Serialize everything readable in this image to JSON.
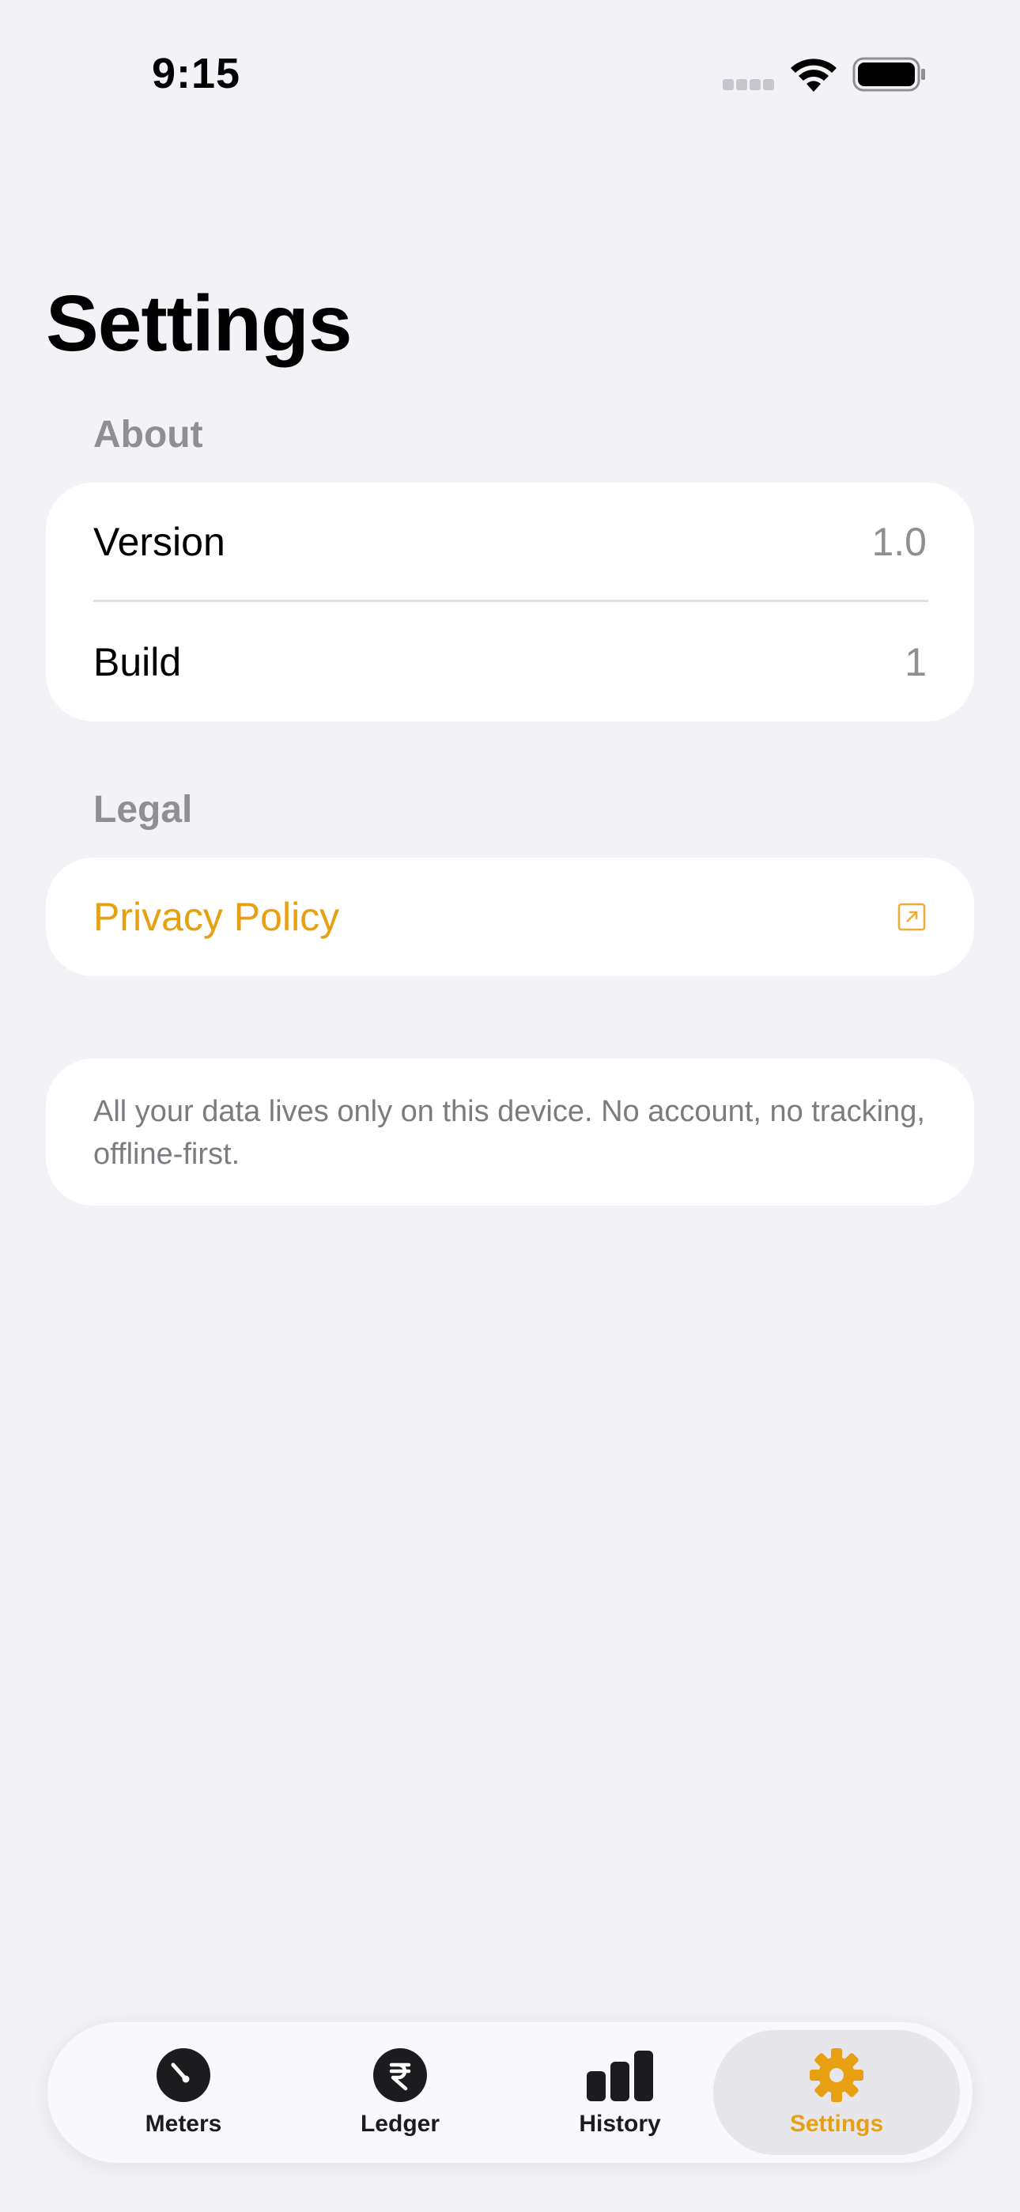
{
  "status_bar": {
    "time": "9:15"
  },
  "title": "Settings",
  "about": {
    "header": "About",
    "rows": [
      {
        "label": "Version",
        "value": "1.0"
      },
      {
        "label": "Build",
        "value": "1"
      }
    ]
  },
  "legal": {
    "header": "Legal",
    "privacy_label": "Privacy Policy"
  },
  "note": "All your data lives only on this device. No account, no tracking, offline-first.",
  "tabs": [
    {
      "label": "Meters",
      "icon": "gauge-icon"
    },
    {
      "label": "Ledger",
      "icon": "rupee-icon"
    },
    {
      "label": "History",
      "icon": "bar-chart-icon"
    },
    {
      "label": "Settings",
      "icon": "gear-icon",
      "active": true
    }
  ],
  "colors": {
    "accent": "#E8A013",
    "background": "#F2F2F7",
    "card": "#FFFFFF",
    "secondary_text": "#8E8E93"
  }
}
